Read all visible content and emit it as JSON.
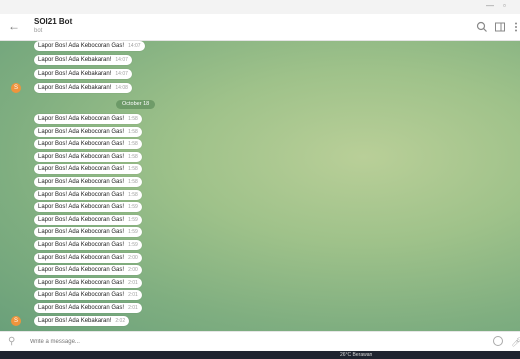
{
  "window": {
    "minimize_icon": "minimize-icon",
    "maximize_icon": "maximize-icon"
  },
  "header": {
    "back_icon": "back-arrow-icon",
    "title": "SOI21 Bot",
    "subtitle": "bot",
    "search_icon": "search-icon",
    "panel_icon": "sidebar-toggle-icon",
    "more_icon": "more-vertical-icon"
  },
  "messages_top": [
    {
      "text": "Lapor Bos! Ada Kebocoran Gas!",
      "time": "14:07"
    },
    {
      "text": "Lapor Bos! Ada Kebakaran!",
      "time": "14:07"
    },
    {
      "text": "Lapor Bos! Ada Kebakaran!",
      "time": "14:07"
    },
    {
      "text": "Lapor Bos! Ada Kebakaran!",
      "time": "14:08",
      "avatar": "S"
    }
  ],
  "date_divider": "October 18",
  "messages_bottom": [
    {
      "text": "Lapor Bos! Ada Kebocoran Gas!",
      "time": "1:58"
    },
    {
      "text": "Lapor Bos! Ada Kebocoran Gas!",
      "time": "1:58"
    },
    {
      "text": "Lapor Bos! Ada Kebocoran Gas!",
      "time": "1:58"
    },
    {
      "text": "Lapor Bos! Ada Kebocoran Gas!",
      "time": "1:58"
    },
    {
      "text": "Lapor Bos! Ada Kebocoran Gas!",
      "time": "1:58"
    },
    {
      "text": "Lapor Bos! Ada Kebocoran Gas!",
      "time": "1:58"
    },
    {
      "text": "Lapor Bos! Ada Kebocoran Gas!",
      "time": "1:58"
    },
    {
      "text": "Lapor Bos! Ada Kebocoran Gas!",
      "time": "1:59"
    },
    {
      "text": "Lapor Bos! Ada Kebocoran Gas!",
      "time": "1:59"
    },
    {
      "text": "Lapor Bos! Ada Kebocoran Gas!",
      "time": "1:59"
    },
    {
      "text": "Lapor Bos! Ada Kebocoran Gas!",
      "time": "1:59"
    },
    {
      "text": "Lapor Bos! Ada Kebocoran Gas!",
      "time": "2:00"
    },
    {
      "text": "Lapor Bos! Ada Kebocoran Gas!",
      "time": "2:00"
    },
    {
      "text": "Lapor Bos! Ada Kebocoran Gas!",
      "time": "2:01"
    },
    {
      "text": "Lapor Bos! Ada Kebocoran Gas!",
      "time": "2:01"
    },
    {
      "text": "Lapor Bos! Ada Kebocoran Gas!",
      "time": "2:01"
    },
    {
      "text": "Lapor Bos! Ada Kebakaran!",
      "time": "2:02",
      "avatar": "S"
    }
  ],
  "composer": {
    "attach_icon": "paperclip-icon",
    "placeholder": "Write a message...",
    "value": "",
    "emoji_icon": "emoji-icon",
    "mic_icon": "microphone-icon"
  },
  "taskbar": {
    "weather": "26°C Berawan"
  },
  "colors": {
    "accent": "#f0943c",
    "chat_bg": "#9fc28a",
    "bubble": "#ffffff"
  }
}
